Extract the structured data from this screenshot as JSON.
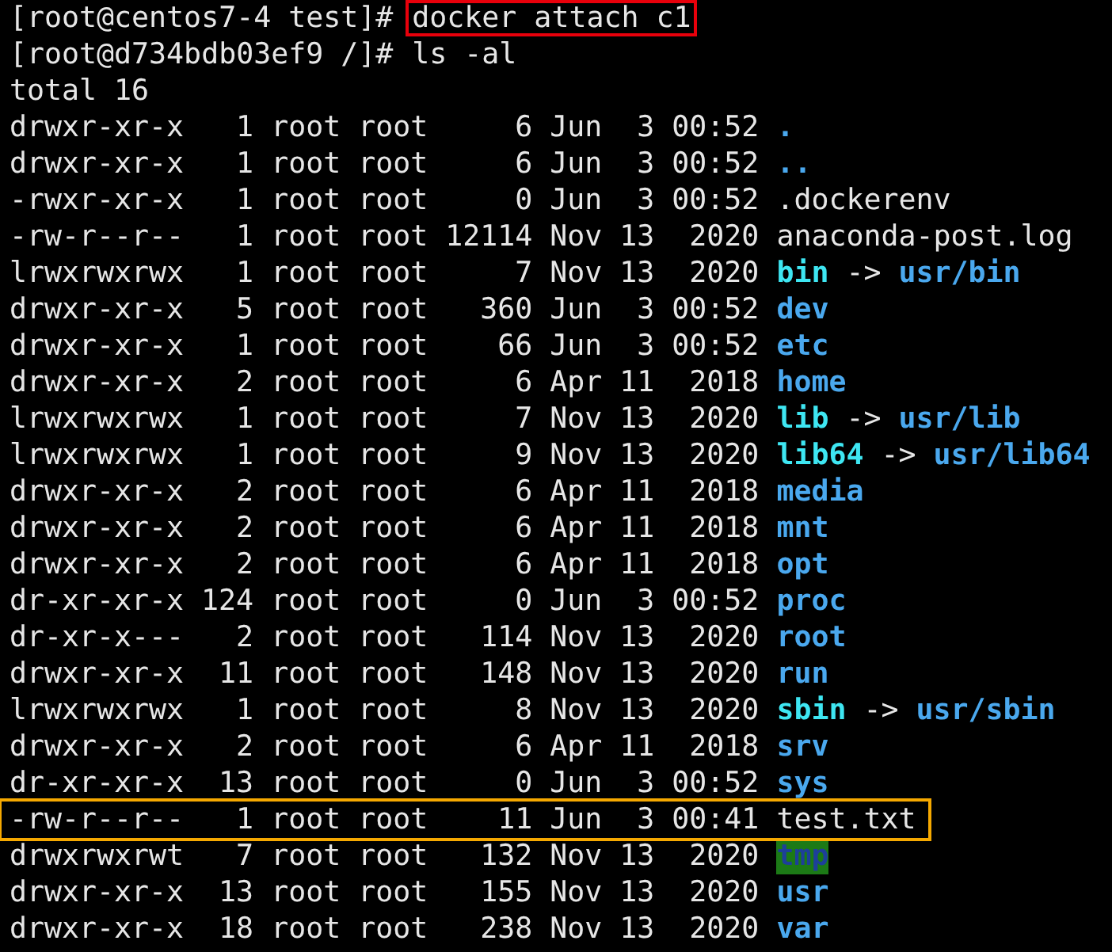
{
  "lines": [
    {
      "kind": "prompt",
      "prompt": "[root@centos7-4 test]#",
      "command": "docker attach c1",
      "boxed": true
    },
    {
      "kind": "prompt",
      "prompt": "[root@d734bdb03ef9 /]#",
      "command": "ls -al",
      "boxed": false
    },
    {
      "kind": "text",
      "text": "total 16"
    },
    {
      "kind": "dir",
      "mode": "drwxr-xr-x",
      "links": "1",
      "owner": "root",
      "group": "root",
      "bytes": "6",
      "month": "Jun",
      "day": "3",
      "time": "00:52",
      "name": ".",
      "boxed": false
    },
    {
      "kind": "dir",
      "mode": "drwxr-xr-x",
      "links": "1",
      "owner": "root",
      "group": "root",
      "bytes": "6",
      "month": "Jun",
      "day": "3",
      "time": "00:52",
      "name": "..",
      "boxed": false
    },
    {
      "kind": "file",
      "mode": "-rwxr-xr-x",
      "links": "1",
      "owner": "root",
      "group": "root",
      "bytes": "0",
      "month": "Jun",
      "day": "3",
      "time": "00:52",
      "name": ".dockerenv",
      "boxed": false
    },
    {
      "kind": "file",
      "mode": "-rw-r--r--",
      "links": "1",
      "owner": "root",
      "group": "root",
      "bytes": "12114",
      "month": "Nov",
      "day": "13",
      "time": "2020",
      "name": "anaconda-post.log",
      "boxed": false
    },
    {
      "kind": "link",
      "mode": "lrwxrwxrwx",
      "links": "1",
      "owner": "root",
      "group": "root",
      "bytes": "7",
      "month": "Nov",
      "day": "13",
      "time": "2020",
      "name": "bin",
      "arrow": "->",
      "target": "usr/bin",
      "boxed": false
    },
    {
      "kind": "dir",
      "mode": "drwxr-xr-x",
      "links": "5",
      "owner": "root",
      "group": "root",
      "bytes": "360",
      "month": "Jun",
      "day": "3",
      "time": "00:52",
      "name": "dev",
      "boxed": false
    },
    {
      "kind": "dir",
      "mode": "drwxr-xr-x",
      "links": "1",
      "owner": "root",
      "group": "root",
      "bytes": "66",
      "month": "Jun",
      "day": "3",
      "time": "00:52",
      "name": "etc",
      "boxed": false
    },
    {
      "kind": "dir",
      "mode": "drwxr-xr-x",
      "links": "2",
      "owner": "root",
      "group": "root",
      "bytes": "6",
      "month": "Apr",
      "day": "11",
      "time": "2018",
      "name": "home",
      "boxed": false
    },
    {
      "kind": "link",
      "mode": "lrwxrwxrwx",
      "links": "1",
      "owner": "root",
      "group": "root",
      "bytes": "7",
      "month": "Nov",
      "day": "13",
      "time": "2020",
      "name": "lib",
      "arrow": "->",
      "target": "usr/lib",
      "boxed": false
    },
    {
      "kind": "link",
      "mode": "lrwxrwxrwx",
      "links": "1",
      "owner": "root",
      "group": "root",
      "bytes": "9",
      "month": "Nov",
      "day": "13",
      "time": "2020",
      "name": "lib64",
      "arrow": "->",
      "target": "usr/lib64",
      "boxed": false
    },
    {
      "kind": "dir",
      "mode": "drwxr-xr-x",
      "links": "2",
      "owner": "root",
      "group": "root",
      "bytes": "6",
      "month": "Apr",
      "day": "11",
      "time": "2018",
      "name": "media",
      "boxed": false
    },
    {
      "kind": "dir",
      "mode": "drwxr-xr-x",
      "links": "2",
      "owner": "root",
      "group": "root",
      "bytes": "6",
      "month": "Apr",
      "day": "11",
      "time": "2018",
      "name": "mnt",
      "boxed": false
    },
    {
      "kind": "dir",
      "mode": "drwxr-xr-x",
      "links": "2",
      "owner": "root",
      "group": "root",
      "bytes": "6",
      "month": "Apr",
      "day": "11",
      "time": "2018",
      "name": "opt",
      "boxed": false
    },
    {
      "kind": "dir",
      "mode": "dr-xr-xr-x",
      "links": "124",
      "owner": "root",
      "group": "root",
      "bytes": "0",
      "month": "Jun",
      "day": "3",
      "time": "00:52",
      "name": "proc",
      "boxed": false
    },
    {
      "kind": "dir",
      "mode": "dr-xr-x---",
      "links": "2",
      "owner": "root",
      "group": "root",
      "bytes": "114",
      "month": "Nov",
      "day": "13",
      "time": "2020",
      "name": "root",
      "boxed": false
    },
    {
      "kind": "dir",
      "mode": "drwxr-xr-x",
      "links": "11",
      "owner": "root",
      "group": "root",
      "bytes": "148",
      "month": "Nov",
      "day": "13",
      "time": "2020",
      "name": "run",
      "boxed": false
    },
    {
      "kind": "link",
      "mode": "lrwxrwxrwx",
      "links": "1",
      "owner": "root",
      "group": "root",
      "bytes": "8",
      "month": "Nov",
      "day": "13",
      "time": "2020",
      "name": "sbin",
      "arrow": "->",
      "target": "usr/sbin",
      "boxed": false
    },
    {
      "kind": "dir",
      "mode": "drwxr-xr-x",
      "links": "2",
      "owner": "root",
      "group": "root",
      "bytes": "6",
      "month": "Apr",
      "day": "11",
      "time": "2018",
      "name": "srv",
      "boxed": false
    },
    {
      "kind": "dir",
      "mode": "dr-xr-xr-x",
      "links": "13",
      "owner": "root",
      "group": "root",
      "bytes": "0",
      "month": "Jun",
      "day": "3",
      "time": "00:52",
      "name": "sys",
      "boxed": false
    },
    {
      "kind": "file",
      "mode": "-rw-r--r--",
      "links": "1",
      "owner": "root",
      "group": "root",
      "bytes": "11",
      "month": "Jun",
      "day": "3",
      "time": "00:41",
      "name": "test.txt",
      "boxed": true
    },
    {
      "kind": "sticky",
      "mode": "drwxrwxrwt",
      "links": "7",
      "owner": "root",
      "group": "root",
      "bytes": "132",
      "month": "Nov",
      "day": "13",
      "time": "2020",
      "name": "tmp",
      "boxed": false
    },
    {
      "kind": "dir",
      "mode": "drwxr-xr-x",
      "links": "13",
      "owner": "root",
      "group": "root",
      "bytes": "155",
      "month": "Nov",
      "day": "13",
      "time": "2020",
      "name": "usr",
      "boxed": false
    },
    {
      "kind": "dir",
      "mode": "drwxr-xr-x",
      "links": "18",
      "owner": "root",
      "group": "root",
      "bytes": "238",
      "month": "Nov",
      "day": "13",
      "time": "2020",
      "name": "var",
      "boxed": false
    }
  ]
}
